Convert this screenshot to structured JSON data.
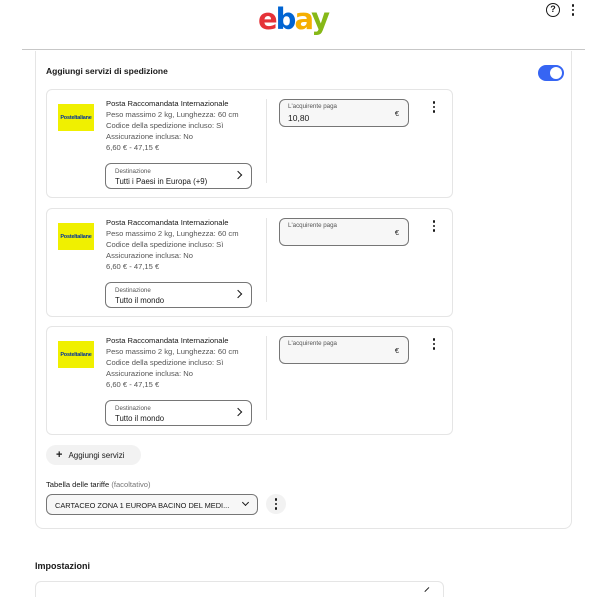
{
  "header": {
    "logo_letters": [
      "e",
      "b",
      "a",
      "y"
    ],
    "logo_colors": [
      "#e53238",
      "#0064d2",
      "#f5af02",
      "#86b817"
    ],
    "help_icon": "?",
    "menu_icon": "vertical-dots-icon"
  },
  "shipping_services": {
    "title": "Aggiungi servizi di spedizione",
    "toggle_on": true,
    "accent_color": "#3665f3",
    "cards": [
      {
        "carrier_logo_text": "PosteItaliane",
        "service_name": "Posta Raccomandata Internazionale",
        "weight_dims": "Peso massimo 2 kg, Lunghezza: 60 cm",
        "tracking": "Codice della spedizione incluso: Sì",
        "insurance": "Assicurazione inclusa: No",
        "price_range": "6,60 € - 47,15 €",
        "destination_label": "Destinazione",
        "destination_value": "Tutti i Paesi in Europa (+9)",
        "buyer_pays_label": "L'acquirente paga",
        "buyer_pays_value": "10,80",
        "currency": "€"
      },
      {
        "carrier_logo_text": "PosteItaliane",
        "service_name": "Posta Raccomandata Internazionale",
        "weight_dims": "Peso massimo 2 kg, Lunghezza: 60 cm",
        "tracking": "Codice della spedizione incluso: Sì",
        "insurance": "Assicurazione inclusa: No",
        "price_range": "6,60 € - 47,15 €",
        "destination_label": "Destinazione",
        "destination_value": "Tutto il mondo",
        "buyer_pays_label": "L'acquirente paga",
        "buyer_pays_value": "",
        "currency": "€"
      },
      {
        "carrier_logo_text": "PosteItaliane",
        "service_name": "Posta Raccomandata Internazionale",
        "weight_dims": "Peso massimo 2 kg, Lunghezza: 60 cm",
        "tracking": "Codice della spedizione incluso: Sì",
        "insurance": "Assicurazione inclusa: No",
        "price_range": "6,60 € - 47,15 €",
        "destination_label": "Destinazione",
        "destination_value": "Tutto il mondo",
        "buyer_pays_label": "L'acquirente paga",
        "buyer_pays_value": "",
        "currency": "€"
      }
    ],
    "add_services_label": "Aggiungi servizi",
    "tariff_table_label": "Tabella delle tariffe",
    "tariff_table_optional": "(facoltativo)",
    "tariff_table_value": "CARTACEO ZONA 1 EUROPA BACINO DEL MEDI..."
  },
  "settings": {
    "title": "Impostazioni"
  }
}
